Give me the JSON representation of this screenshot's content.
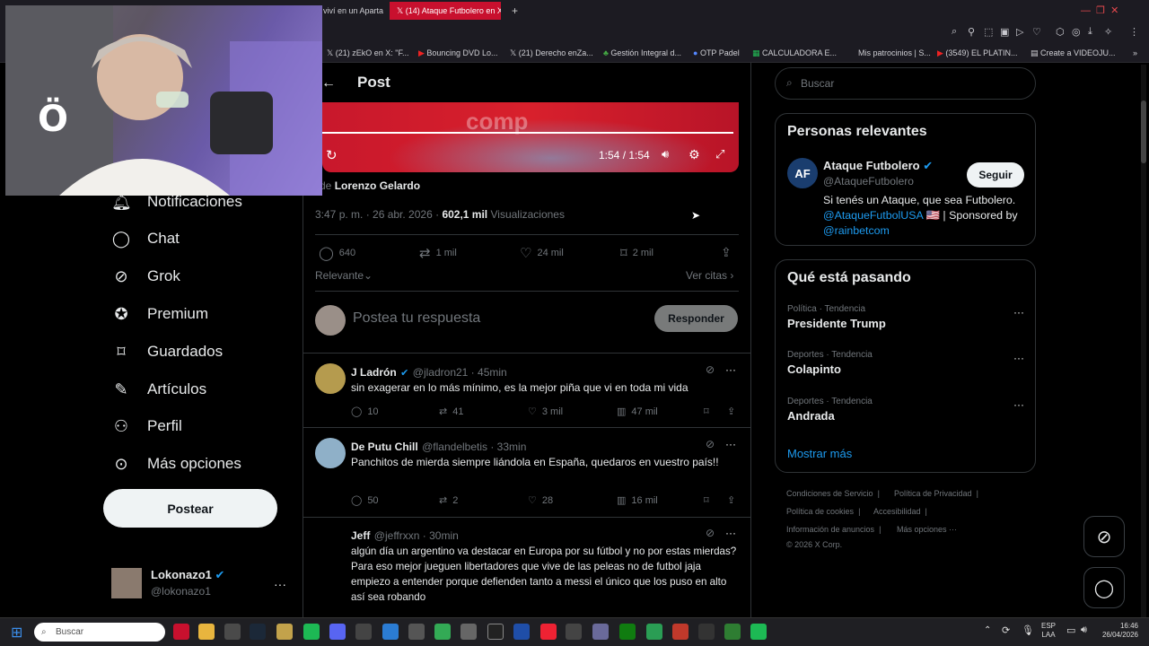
{
  "browser": {
    "tabs": [
      {
        "label": "viví en un Aparta"
      },
      {
        "label": "(14) Ataque Futbolero en X"
      }
    ],
    "bookmarks": [
      "(21) zEkO en X: \"F...",
      "Bouncing DVD Lo...",
      "(21) Derecho enZa...",
      "Gestión Integral d...",
      "OTP Padel",
      "CALCULADORA E...",
      "Mis patrocinios | S...",
      "(3549) EL PLATIN...",
      "Create a VIDEOJU..."
    ]
  },
  "sidebar": {
    "items": [
      {
        "label": "Notificaciones",
        "icon": "bell-icon"
      },
      {
        "label": "Chat",
        "icon": "chat-icon"
      },
      {
        "label": "Grok",
        "icon": "grok-icon"
      },
      {
        "label": "Premium",
        "icon": "premium-icon"
      },
      {
        "label": "Guardados",
        "icon": "bookmark-icon"
      },
      {
        "label": "Artículos",
        "icon": "article-icon"
      },
      {
        "label": "Perfil",
        "icon": "person-icon"
      },
      {
        "label": "Más opciones",
        "icon": "more-circle-icon"
      }
    ],
    "post_button": "Postear",
    "account": {
      "name": "Lokonazo1",
      "handle": "@lokonazo1"
    }
  },
  "main": {
    "header": "Post",
    "video": {
      "time": "1:54 / 1:54"
    },
    "author_line_prefix": "de",
    "author_line_name": "Lorenzo Gelardo",
    "timestamp": "3:47 p. m. · 26 abr. 2026 ·",
    "views_count": "602,1 mil",
    "views_label": "Visualizaciones",
    "stats": {
      "replies": "640",
      "reposts": "1 mil",
      "likes": "24 mil",
      "bookmarks": "2 mil"
    },
    "sort_label": "Relevante",
    "quotes_label": "Ver citas",
    "reply_placeholder": "Postea tu respuesta",
    "reply_button": "Responder",
    "replies": [
      {
        "name": "J Ladrón",
        "handle": "@jladron21 · 45min",
        "verified": true,
        "text": "sin exagerar en lo más mínimo, es la mejor piña que vi en toda mi vida",
        "comments": "10",
        "reposts": "41",
        "likes": "3 mil",
        "views": "47 mil"
      },
      {
        "name": "De Putu Chill",
        "handle": "@flandelbetis · 33min",
        "verified": false,
        "text": "Panchitos de mierda siempre liándola en España,  quedaros en vuestro país!!",
        "comments": "50",
        "reposts": "2",
        "likes": "28",
        "views": "16 mil"
      },
      {
        "name": "Jeff",
        "handle": "@jeffrxxn · 30min",
        "verified": false,
        "text": "algún día un argentino va destacar en Europa por su fútbol y no por estas mierdas? Para eso mejor jueguen libertadores que vive de las peleas no de futbol jaja empiezo a entender porque defienden tanto a messi el único que los puso en alto así sea robando"
      }
    ]
  },
  "right": {
    "search_placeholder": "Buscar",
    "relevant": {
      "title": "Personas relevantes",
      "name": "Ataque Futbolero",
      "handle": "@AtaqueFutbolero",
      "follow": "Seguir",
      "bio_1": "Si tenés un Ataque, que sea Futbolero.",
      "bio_link_1": "@AtaqueFutbolUSA",
      "bio_mid": "🇺🇸 | Sponsored by",
      "bio_link_2": "@rainbetcom"
    },
    "trends": {
      "title": "Qué está pasando",
      "items": [
        {
          "category": "Política · Tendencia",
          "name": "Presidente Trump"
        },
        {
          "category": "Deportes · Tendencia",
          "name": "Colapinto"
        },
        {
          "category": "Deportes · Tendencia",
          "name": "Andrada"
        }
      ],
      "more": "Mostrar más"
    },
    "footer": [
      "Condiciones de Servicio",
      "Política de Privacidad",
      "Política de cookies",
      "Accesibilidad",
      "Información de anuncios",
      "Más opciones ···",
      "© 2026 X Corp."
    ]
  },
  "taskbar": {
    "search": "Buscar",
    "lang_1": "ESP",
    "lang_2": "LAA",
    "time": "16:46",
    "date": "26/04/2026"
  },
  "colors": {
    "accent": "#1d9bf0",
    "active_tab": "#c8102e",
    "page_bg": "#000000"
  }
}
